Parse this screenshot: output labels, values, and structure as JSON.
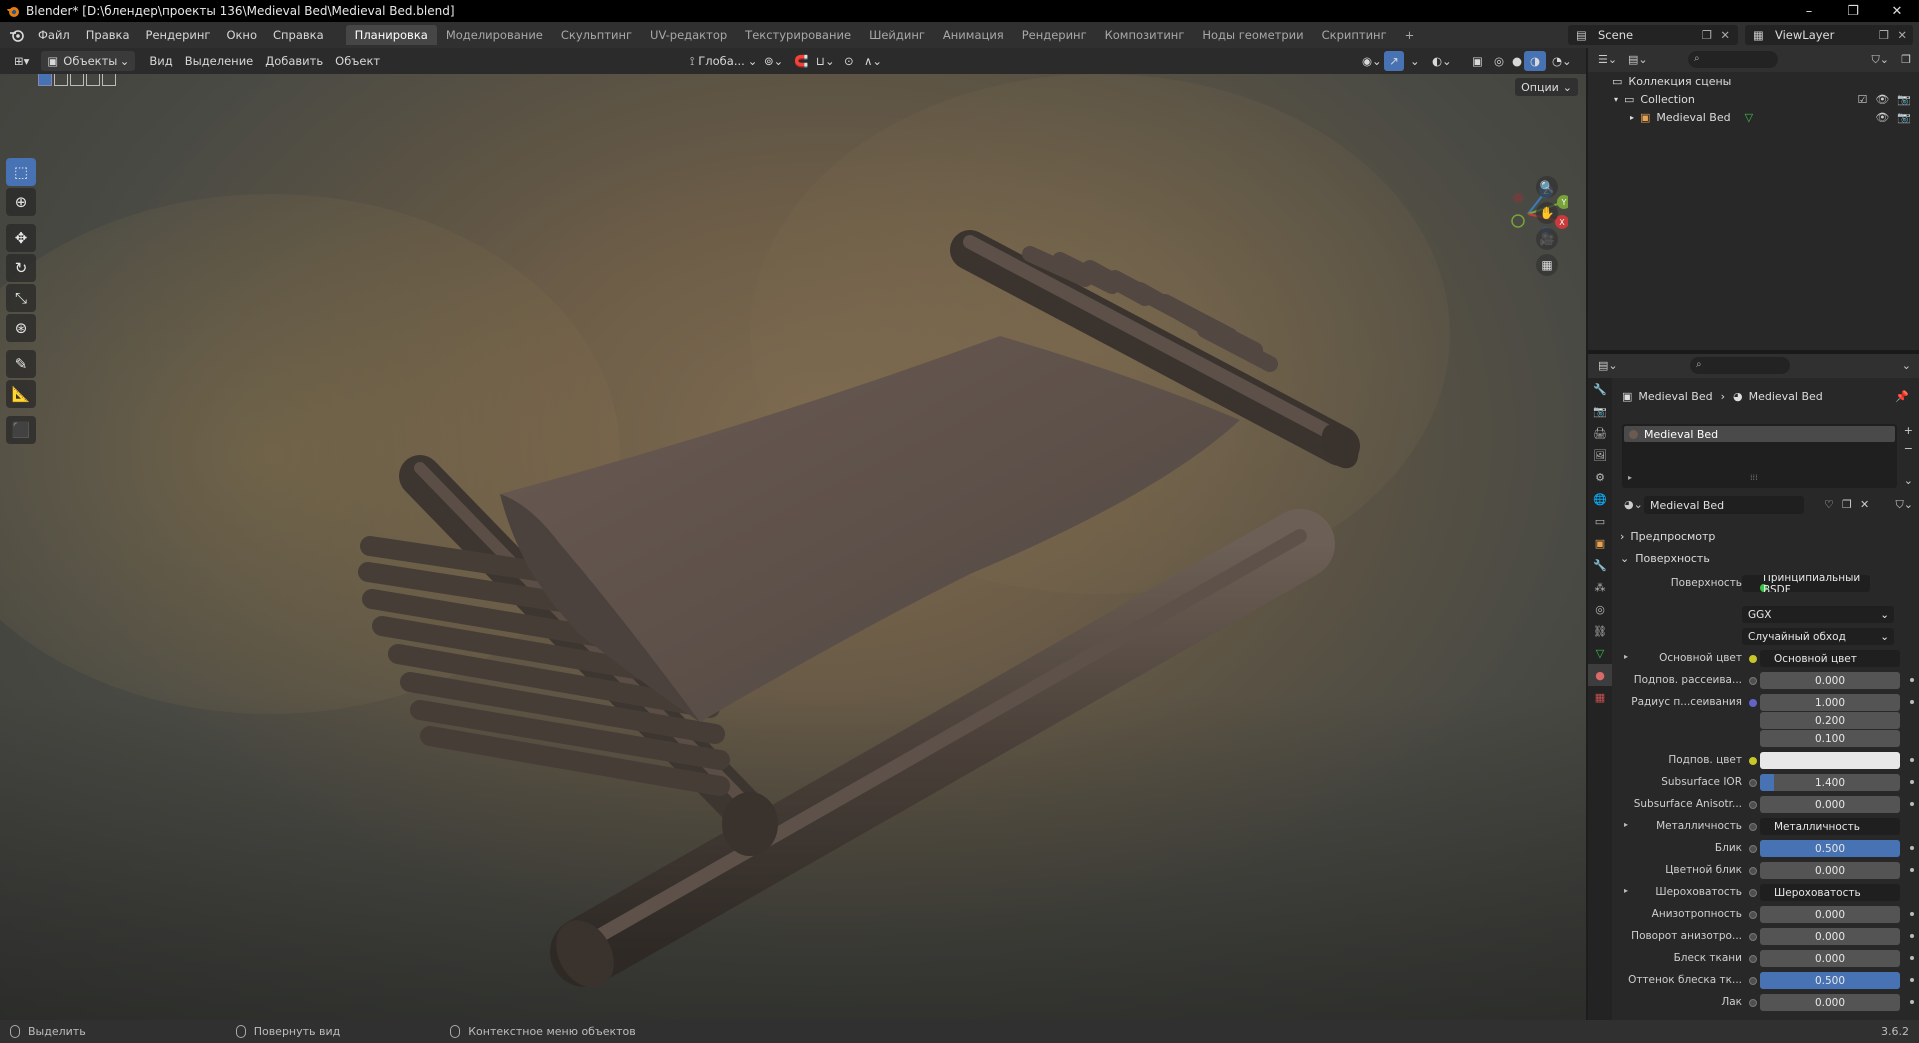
{
  "window": {
    "title": "Blender* [D:\\блендер\\проекты 136\\Medieval Bed\\Medieval Bed.blend]",
    "minimize": "–",
    "maximize": "❐",
    "close": "✕"
  },
  "menu": [
    "Файл",
    "Правка",
    "Рендеринг",
    "Окно",
    "Справка"
  ],
  "workspaces": [
    "Планировка",
    "Моделирование",
    "Скульптинг",
    "UV-редактор",
    "Текстурирование",
    "Шейдинг",
    "Анимация",
    "Рендеринг",
    "Композитинг",
    "Ноды геометрии",
    "Скриптинг"
  ],
  "workspace_add": "+",
  "scene": "Scene",
  "view_layer": "ViewLayer",
  "viewport_header": {
    "mode": "Объекты",
    "view": "Вид",
    "select": "Выделение",
    "add": "Добавить",
    "object": "Объект",
    "transform_orientation": "Глоба...",
    "options": "Опции"
  },
  "gizmo": {
    "z": "Z",
    "y": "Y",
    "x": "X"
  },
  "outliner": {
    "scene_collection": "Коллекция сцены",
    "collection": "Collection",
    "object": "Medieval Bed"
  },
  "properties": {
    "breadcrumb_object": "Medieval Bed",
    "breadcrumb_material": "Medieval Bed",
    "slot": "Medieval Bed",
    "material_name": "Medieval Bed",
    "preview_panel": "Предпросмотр",
    "surface_panel": "Поверхность",
    "rows": {
      "surface_label": "Поверхность",
      "surface_value": "Принципиальный BSDF",
      "distribution": "GGX",
      "subsurface_method": "Случайный обход",
      "base_color_label": "Основной цвет",
      "base_color_value": "Основной цвет",
      "subsurface_weight_label": "Подпов. рассеива...",
      "subsurface_weight_value": "0.000",
      "subsurface_radius_label": "Радиус п...сеивания",
      "subsurface_radius_x": "1.000",
      "subsurface_radius_y": "0.200",
      "subsurface_radius_z": "0.100",
      "subsurface_color_label": "Подпов. цвет",
      "subsurface_ior_label": "Subsurface IOR",
      "subsurface_ior_value": "1.400",
      "subsurface_aniso_label": "Subsurface Anisotr...",
      "subsurface_aniso_value": "0.000",
      "metallic_label": "Металличность",
      "metallic_value": "Металличность",
      "specular_label": "Блик",
      "specular_value": "0.500",
      "specular_tint_label": "Цветной блик",
      "specular_tint_value": "0.000",
      "roughness_label": "Шероховатость",
      "roughness_value": "Шероховатость",
      "anisotropic_label": "Анизотропность",
      "anisotropic_value": "0.000",
      "aniso_rotation_label": "Поворот анизотро...",
      "aniso_rotation_value": "0.000",
      "sheen_label": "Блеск ткани",
      "sheen_value": "0.000",
      "sheen_tint_label": "Оттенок блеска тк...",
      "sheen_tint_value": "0.500",
      "clearcoat_label": "Лак",
      "clearcoat_value": "0.000"
    },
    "fills": {
      "subsurface_ior": 0.1,
      "specular": 1.0,
      "sheen_tint": 1.0
    }
  },
  "status": {
    "left": "Выделить",
    "middle": "Повернуть вид",
    "right": "Контекстное меню объектов",
    "version": "3.6.2"
  }
}
